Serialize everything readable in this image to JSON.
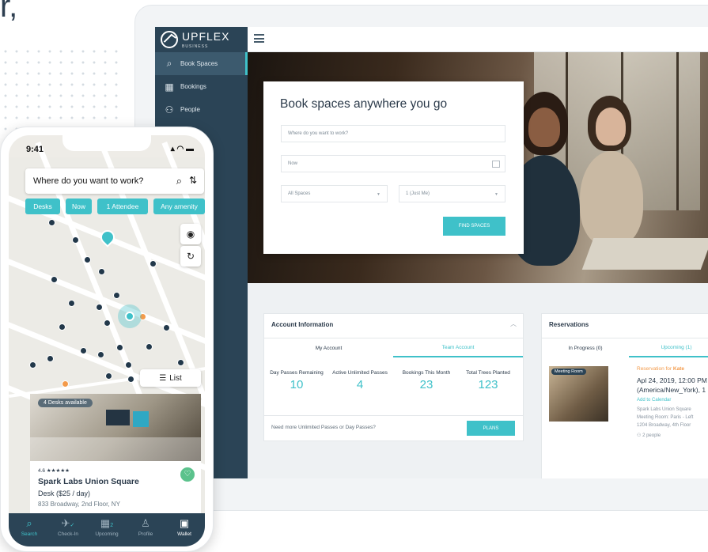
{
  "headline_fragment": "r,",
  "desktop": {
    "logo": {
      "name": "UPFLEX",
      "sub": "BUSINESS"
    },
    "sidebar": [
      {
        "label": "Book Spaces",
        "icon": "search-icon"
      },
      {
        "label": "Bookings",
        "icon": "calendar-icon"
      },
      {
        "label": "People",
        "icon": "people-icon"
      }
    ],
    "booking_card": {
      "title": "Book spaces anywhere you go",
      "where_placeholder": "Where do you want to work?",
      "when_value": "Now",
      "space_type": "All Spaces",
      "attendees": "1 (Just Me)",
      "submit": "FIND SPACES"
    },
    "account": {
      "title": "Account Information",
      "tabs": [
        "My Account",
        "Team Account"
      ],
      "stats": [
        {
          "label": "Day Passes Remaining",
          "value": "10"
        },
        {
          "label": "Active Unlimited Passes",
          "value": "4"
        },
        {
          "label": "Bookings This Month",
          "value": "23"
        },
        {
          "label": "Total Trees Planted",
          "value": "123"
        }
      ],
      "footer_text": "Need more Unlimited Passes or Day Passes?",
      "plans_button": "PLANS"
    },
    "reservations": {
      "title": "Reservations",
      "tabs": [
        "In Progress (0)",
        "Upcoming (1)"
      ],
      "item": {
        "badge": "Meeting Room",
        "for_label": "Reservation for",
        "for_name": "Kate",
        "datetime": "Apl 24, 2019, 12:00 PM",
        "timezone": "(America/New_York), 1",
        "add_calendar": "Add to Calendar",
        "venue": "Spark Labs Union Square",
        "room": "Meeting Room: Paris - Left",
        "address": "1204 Broadway, 4th Floor",
        "people": "2 people"
      }
    }
  },
  "phone": {
    "time": "9:41",
    "search_placeholder": "Where do you want to work?",
    "filters": [
      "Desks",
      "Now",
      "1 Attendee",
      "Any amenity"
    ],
    "list_button": "List",
    "listing": {
      "badge": "4 Desks available",
      "rating": "4.6 ★★★★★",
      "name": "Spark Labs Union Square",
      "price": "Desk ($25 / day)",
      "address": "833 Broadway, 2nd Floor, NY"
    },
    "tabs": [
      {
        "label": "Search",
        "icon": "search-icon"
      },
      {
        "label": "Check-In",
        "icon": "checkin-icon",
        "badge": "✓"
      },
      {
        "label": "Upcoming",
        "icon": "upcoming-icon",
        "badge": "2"
      },
      {
        "label": "Profile",
        "icon": "profile-icon"
      },
      {
        "label": "Wallet",
        "icon": "wallet-icon"
      }
    ]
  },
  "colors": {
    "accent": "#3fc1c9",
    "sidebar": "#2b4456",
    "orange": "#f39a4a"
  }
}
